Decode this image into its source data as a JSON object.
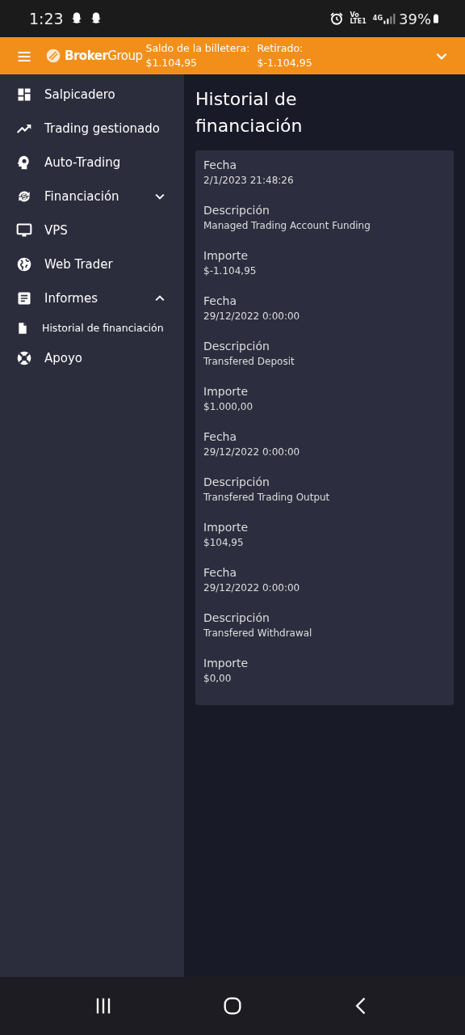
{
  "status_bar": {
    "time": "1:23",
    "network": "Vo\nLTE1",
    "generation": "4G",
    "battery": "39%"
  },
  "header": {
    "brand": "**Broker**Group",
    "balance_label": "Saldo de la billetera: $1.104,95",
    "withdrawn_label": "Retirado: $-1.104,95",
    "expanded": false
  },
  "sidebar": {
    "items": [
      {
        "label": "Salpicadero"
      },
      {
        "label": "Trading gestionado"
      },
      {
        "label": "Auto-Trading"
      },
      {
        "label": "Financiación",
        "expanded": false
      },
      {
        "label": "VPS"
      },
      {
        "label": "Web Trader"
      },
      {
        "label": "Informes",
        "expanded": true,
        "children": [
          {
            "label": "Historial de financiación"
          }
        ]
      },
      {
        "label": "Apoyo"
      }
    ]
  },
  "page_title": "Historial de financiación",
  "records": [
    {
      "fields": [
        {
          "label": "Fecha",
          "value": "2/1/2023 21:48:26"
        },
        {
          "label": "Descripción",
          "value": "Managed Trading Account Funding"
        },
        {
          "label": "Importe",
          "value": "$-1.104,95"
        }
      ]
    },
    {
      "fields": [
        {
          "label": "Fecha",
          "value": "29/12/2022 0:00:00"
        },
        {
          "label": "Descripción",
          "value": "Transfered Deposit"
        },
        {
          "label": "Importe",
          "value": "$1.000,00"
        }
      ]
    },
    {
      "fields": [
        {
          "label": "Fecha",
          "value": "29/12/2022 0:00:00"
        },
        {
          "label": "Descripción",
          "value": "Transfered Trading Output"
        },
        {
          "label": "Importe",
          "value": "$104,95"
        }
      ]
    },
    {
      "fields": [
        {
          "label": "Fecha",
          "value": "29/12/2022 0:00:00"
        },
        {
          "label": "Descripción",
          "value": "Transfered Withdrawal"
        },
        {
          "label": "Importe",
          "value": "$0,00"
        }
      ]
    }
  ]
}
